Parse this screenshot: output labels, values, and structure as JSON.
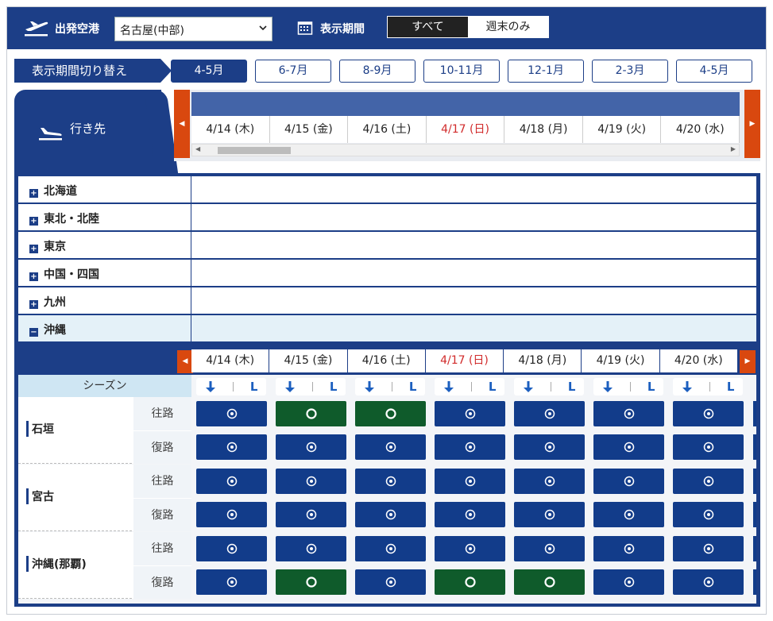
{
  "header": {
    "departure_label": "出発空港",
    "departure_value": "名古屋(中部)",
    "period_label": "表示期間",
    "filter_all": "すべて",
    "filter_weekend": "週末のみ"
  },
  "period_switch": {
    "label": "表示期間切り替え",
    "tabs": [
      "4-5月",
      "6-7月",
      "8-9月",
      "10-11月",
      "12-1月",
      "2-3月",
      "4-5月"
    ],
    "active_index": 0
  },
  "destination_header": "行き先",
  "dates": [
    {
      "label": "4/14 (木)",
      "sunday": false
    },
    {
      "label": "4/15 (金)",
      "sunday": false
    },
    {
      "label": "4/16 (土)",
      "sunday": false
    },
    {
      "label": "4/17 (日)",
      "sunday": true
    },
    {
      "label": "4/18 (月)",
      "sunday": false
    },
    {
      "label": "4/19 (火)",
      "sunday": false
    },
    {
      "label": "4/20 (水)",
      "sunday": false
    }
  ],
  "regions": [
    "北海道",
    "東北・北陸",
    "東京",
    "中国・四国",
    "九州",
    "沖縄"
  ],
  "open_region": "沖縄",
  "season_label": "シーズン",
  "dir_chip": {
    "l_label": "L"
  },
  "leg_labels": {
    "outbound": "往路",
    "return": "復路"
  },
  "destinations": [
    {
      "name": "石垣",
      "outbound": [
        "blue",
        "green",
        "green",
        "blue",
        "blue",
        "blue",
        "blue"
      ],
      "return": [
        "blue",
        "blue",
        "blue",
        "blue",
        "blue",
        "blue",
        "blue"
      ]
    },
    {
      "name": "宮古",
      "outbound": [
        "blue",
        "blue",
        "blue",
        "blue",
        "blue",
        "blue",
        "blue"
      ],
      "return": [
        "blue",
        "blue",
        "blue",
        "blue",
        "blue",
        "blue",
        "blue"
      ]
    },
    {
      "name": "沖縄(那覇)",
      "outbound": [
        "blue",
        "blue",
        "blue",
        "blue",
        "blue",
        "blue",
        "blue"
      ],
      "return": [
        "blue",
        "green",
        "blue",
        "green",
        "green",
        "blue",
        "blue"
      ]
    }
  ],
  "colors": {
    "brand": "#1c3e87",
    "green": "#0f5b2b",
    "sunday": "#d12b2b",
    "nav_orange": "#d9480f"
  }
}
